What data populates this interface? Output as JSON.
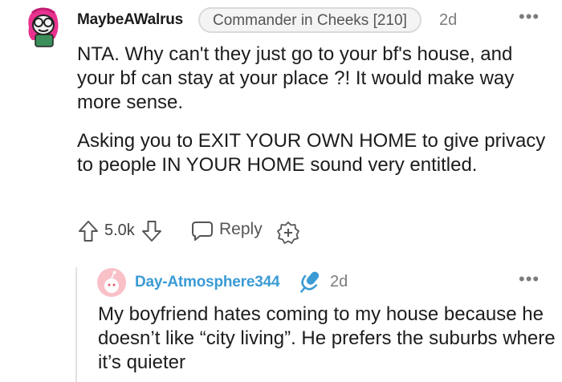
{
  "comment": {
    "username": "MaybeAWalrus",
    "flair": "Commander in Cheeks [210]",
    "time": "2d",
    "more": "•••",
    "paragraphs": [
      "NTA. Why can't they just go to your bf's house, and your bf can stay at your place ?! It would make way more sense.",
      "Asking you to EXIT YOUR OWN HOME to give privacy to people IN YOUR HOME sound very entitled."
    ],
    "score": "5.0k",
    "reply_label": "Reply",
    "icons": [
      "upvote-icon",
      "downvote-icon",
      "reply-icon",
      "award-icon",
      "more-icon"
    ]
  },
  "reply": {
    "username": "Day-Atmosphere344",
    "time": "2d",
    "more": "•••",
    "text": "My boyfriend hates coming to my house because he doesn’t like “city living”. He prefers the suburbs where it’s quieter",
    "icons": [
      "avatar-icon",
      "microphone-icon",
      "more-icon"
    ]
  },
  "colors": {
    "reply_username": "#3a9bd5",
    "reply_avatar_bg": "#f9c0c7",
    "muted": "#7c7c7c"
  }
}
